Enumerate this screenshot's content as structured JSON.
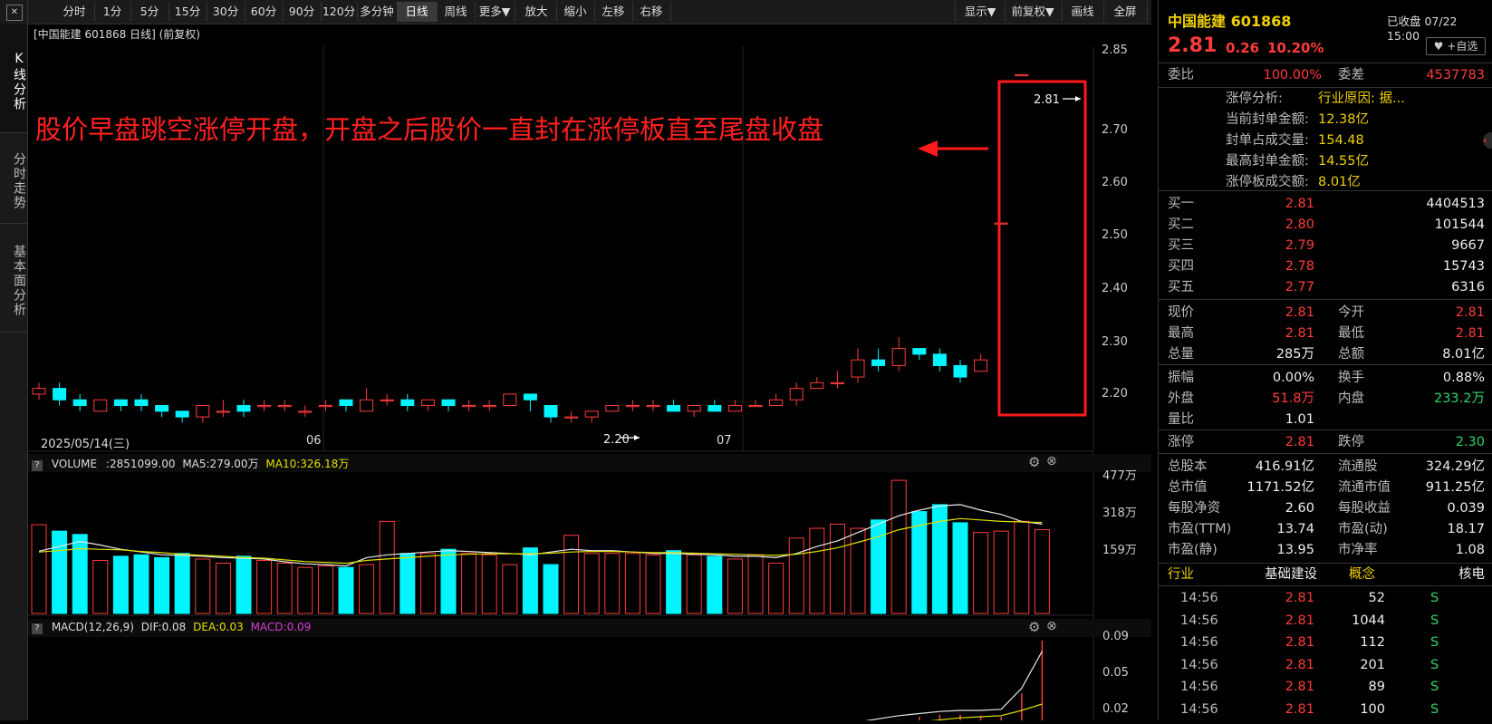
{
  "left_tabs": [
    "K线分析",
    "分时走势",
    "基本面分析"
  ],
  "toolbar": {
    "periods": [
      "分时",
      "1分",
      "5分",
      "15分",
      "30分",
      "60分",
      "90分",
      "120分",
      "多分钟",
      "日线",
      "周线",
      "更多▼"
    ],
    "active_period": "日线",
    "actions": [
      "放大",
      "缩小",
      "左移",
      "右移"
    ],
    "right_actions": [
      "显示▼",
      "前复权▼",
      "画线",
      "全屏"
    ]
  },
  "chart": {
    "title": "[中国能建 601868 日线]  (前复权)",
    "annotation": "股价早盘跳空涨停开盘，开盘之后股价一直封在涨停板直至尾盘收盘",
    "max_label": "2.81",
    "min_label": "2.20",
    "date_labels": [
      "2025/05/14(三)",
      "06",
      "07"
    ],
    "price_ticks": [
      "2.85",
      "2.70",
      "2.60",
      "2.50",
      "2.40",
      "2.30",
      "2.20"
    ],
    "volume_header": {
      "name": "VOLUME",
      "value": ":2851099.00",
      "ma5": "MA5:279.00万",
      "ma10": "MA10:326.18万"
    },
    "volume_ticks": [
      "477万",
      "318万",
      "159万"
    ],
    "macd_header": {
      "name": "MACD(12,26,9)",
      "dif": "DIF:0.08",
      "dea": "DEA:0.03",
      "macd": "MACD:0.09"
    },
    "macd_ticks": [
      "0.09",
      "0.05",
      "0.02"
    ],
    "colors": {
      "up": "#ff3b3b",
      "down": "#00f5ff",
      "ma5": "#e8e8e8",
      "ma10": "#e0e000",
      "annot": "#ff2020",
      "macd": "#d13cd1"
    }
  },
  "chart_data": {
    "type": "candlestick",
    "price_range": [
      2.18,
      2.86
    ],
    "candles": [
      [
        2.25,
        2.26,
        2.24,
        2.27
      ],
      [
        2.26,
        2.24,
        2.23,
        2.27
      ],
      [
        2.24,
        2.23,
        2.22,
        2.25
      ],
      [
        2.22,
        2.24,
        2.22,
        2.24
      ],
      [
        2.24,
        2.23,
        2.22,
        2.24
      ],
      [
        2.24,
        2.23,
        2.22,
        2.25
      ],
      [
        2.23,
        2.22,
        2.21,
        2.23
      ],
      [
        2.22,
        2.21,
        2.2,
        2.22
      ],
      [
        2.21,
        2.23,
        2.2,
        2.23
      ],
      [
        2.22,
        2.22,
        2.21,
        2.24
      ],
      [
        2.23,
        2.22,
        2.21,
        2.24
      ],
      [
        2.23,
        2.23,
        2.22,
        2.24
      ],
      [
        2.23,
        2.23,
        2.22,
        2.24
      ],
      [
        2.22,
        2.22,
        2.21,
        2.23
      ],
      [
        2.23,
        2.23,
        2.22,
        2.24
      ],
      [
        2.24,
        2.23,
        2.22,
        2.24
      ],
      [
        2.22,
        2.24,
        2.22,
        2.26
      ],
      [
        2.24,
        2.24,
        2.23,
        2.25
      ],
      [
        2.24,
        2.23,
        2.22,
        2.25
      ],
      [
        2.23,
        2.24,
        2.22,
        2.24
      ],
      [
        2.24,
        2.23,
        2.22,
        2.24
      ],
      [
        2.23,
        2.23,
        2.22,
        2.24
      ],
      [
        2.23,
        2.23,
        2.22,
        2.24
      ],
      [
        2.23,
        2.25,
        2.23,
        2.25
      ],
      [
        2.25,
        2.24,
        2.22,
        2.25
      ],
      [
        2.23,
        2.21,
        2.2,
        2.23
      ],
      [
        2.21,
        2.21,
        2.2,
        2.22
      ],
      [
        2.21,
        2.22,
        2.2,
        2.22
      ],
      [
        2.22,
        2.23,
        2.22,
        2.23
      ],
      [
        2.23,
        2.23,
        2.22,
        2.24
      ],
      [
        2.23,
        2.23,
        2.22,
        2.24
      ],
      [
        2.23,
        2.22,
        2.22,
        2.24
      ],
      [
        2.22,
        2.23,
        2.21,
        2.23
      ],
      [
        2.23,
        2.22,
        2.22,
        2.24
      ],
      [
        2.22,
        2.23,
        2.22,
        2.24
      ],
      [
        2.23,
        2.23,
        2.23,
        2.24
      ],
      [
        2.23,
        2.24,
        2.23,
        2.25
      ],
      [
        2.24,
        2.26,
        2.23,
        2.27
      ],
      [
        2.26,
        2.27,
        2.26,
        2.28
      ],
      [
        2.27,
        2.27,
        2.26,
        2.29
      ],
      [
        2.28,
        2.31,
        2.27,
        2.33
      ],
      [
        2.31,
        2.3,
        2.29,
        2.33
      ],
      [
        2.3,
        2.33,
        2.29,
        2.35
      ],
      [
        2.33,
        2.32,
        2.31,
        2.33
      ],
      [
        2.32,
        2.3,
        2.29,
        2.33
      ],
      [
        2.3,
        2.28,
        2.27,
        2.31
      ],
      [
        2.29,
        2.31,
        2.29,
        2.32
      ],
      [
        2.55,
        2.55,
        2.55,
        2.55
      ],
      [
        2.81,
        2.81,
        2.81,
        2.81
      ]
    ],
    "volume": [
      318,
      295,
      283,
      190,
      205,
      210,
      200,
      215,
      195,
      180,
      205,
      190,
      180,
      165,
      170,
      165,
      175,
      330,
      215,
      215,
      230,
      215,
      210,
      175,
      235,
      175,
      280,
      215,
      215,
      215,
      210,
      225,
      210,
      205,
      195,
      210,
      180,
      270,
      305,
      320,
      305,
      335,
      477,
      365,
      390,
      325,
      290,
      295,
      330,
      300
    ],
    "volume_max": 500,
    "ma5": [
      223,
      240,
      258,
      245,
      230,
      220,
      210,
      208,
      205,
      200,
      198,
      195,
      185,
      178,
      175,
      170,
      200,
      210,
      215,
      220,
      225,
      222,
      218,
      215,
      210,
      220,
      230,
      225,
      225,
      220,
      215,
      215,
      212,
      210,
      205,
      205,
      200,
      215,
      240,
      260,
      290,
      320,
      350,
      370,
      385,
      390,
      370,
      355,
      330,
      320
    ],
    "ma10": [
      220,
      225,
      232,
      230,
      228,
      222,
      218,
      212,
      208,
      205,
      200,
      198,
      192,
      186,
      183,
      180,
      190,
      195,
      200,
      205,
      210,
      212,
      214,
      214,
      214,
      216,
      220,
      222,
      222,
      220,
      218,
      218,
      216,
      214,
      212,
      210,
      208,
      212,
      222,
      235,
      255,
      275,
      300,
      315,
      330,
      340,
      335,
      330,
      328,
      326
    ],
    "macd": [
      0.002,
      0.002,
      0.001,
      0.001,
      0.001,
      0.001,
      0.0,
      0.0,
      0.0,
      0.0,
      0.001,
      0.001,
      0.001,
      0.001,
      0.002,
      0.002,
      0.002,
      0.003,
      0.003,
      0.003,
      0.003,
      0.003,
      0.003,
      0.004,
      0.004,
      0.004,
      0.003,
      0.002,
      0.002,
      0.002,
      0.002,
      0.002,
      0.002,
      0.002,
      0.003,
      0.003,
      0.003,
      0.005,
      0.006,
      0.008,
      0.01,
      0.012,
      0.015,
      0.018,
      0.02,
      0.02,
      0.019,
      0.018,
      0.04,
      0.09
    ],
    "dif": [
      0.0,
      0.0,
      0.0,
      0.001,
      0.001,
      0.002,
      0.002,
      0.002,
      0.003,
      0.003,
      0.003,
      0.003,
      0.004,
      0.004,
      0.004,
      0.004,
      0.004,
      0.004,
      0.004,
      0.004,
      0.004,
      0.004,
      0.004,
      0.004,
      0.004,
      0.004,
      0.002,
      0.001,
      0.001,
      0.001,
      0.001,
      0.001,
      0.001,
      0.001,
      0.002,
      0.002,
      0.003,
      0.005,
      0.007,
      0.01,
      0.013,
      0.016,
      0.019,
      0.021,
      0.023,
      0.024,
      0.024,
      0.025,
      0.045,
      0.08
    ],
    "dea": [
      0.0,
      0.0,
      0.0,
      0.0,
      0.001,
      0.001,
      0.001,
      0.002,
      0.002,
      0.002,
      0.002,
      0.003,
      0.003,
      0.003,
      0.003,
      0.003,
      0.003,
      0.003,
      0.003,
      0.003,
      0.003,
      0.003,
      0.003,
      0.003,
      0.003,
      0.003,
      0.003,
      0.002,
      0.002,
      0.002,
      0.002,
      0.002,
      0.002,
      0.002,
      0.002,
      0.002,
      0.002,
      0.003,
      0.004,
      0.005,
      0.007,
      0.009,
      0.011,
      0.013,
      0.015,
      0.017,
      0.018,
      0.019,
      0.024,
      0.03
    ],
    "macd_range": [
      0.0,
      0.09
    ]
  },
  "panel": {
    "name": "中国能建",
    "code": "601868",
    "status": "已收盘 07/22 15:00",
    "price": "2.81",
    "change": "0.26",
    "pct": "10.20%",
    "fav_label": "+自选",
    "weibi_label": "委比",
    "weibi": "100.00%",
    "weicha_label": "委差",
    "weicha": "4537783",
    "limit_info": [
      {
        "label": "涨停分析:",
        "value": "行业原因: 据..."
      },
      {
        "label": "当前封单金额:",
        "value": "12.38亿"
      },
      {
        "label": "封单占成交量:",
        "value": "154.48"
      },
      {
        "label": "最高封单金额:",
        "value": "14.55亿"
      },
      {
        "label": "涨停板成交额:",
        "value": "8.01亿"
      }
    ],
    "bids": [
      {
        "label": "买一",
        "price": "2.81",
        "vol": "4404513"
      },
      {
        "label": "买二",
        "price": "2.80",
        "vol": "101544"
      },
      {
        "label": "买三",
        "price": "2.79",
        "vol": "9667"
      },
      {
        "label": "买四",
        "price": "2.78",
        "vol": "15743"
      },
      {
        "label": "买五",
        "price": "2.77",
        "vol": "6316"
      }
    ],
    "quote": [
      [
        {
          "l": "现价",
          "v": "2.81",
          "c": "red"
        },
        {
          "l": "今开",
          "v": "2.81",
          "c": "red"
        }
      ],
      [
        {
          "l": "最高",
          "v": "2.81",
          "c": "red"
        },
        {
          "l": "最低",
          "v": "2.81",
          "c": "red"
        }
      ],
      [
        {
          "l": "总量",
          "v": "285万",
          "c": "white"
        },
        {
          "l": "总额",
          "v": "8.01亿",
          "c": "white"
        }
      ]
    ],
    "quote2": [
      [
        {
          "l": "振幅",
          "v": "0.00%",
          "c": "white"
        },
        {
          "l": "换手",
          "v": "0.88%",
          "c": "white"
        }
      ],
      [
        {
          "l": "外盘",
          "v": "51.8万",
          "c": "red"
        },
        {
          "l": "内盘",
          "v": "233.2万",
          "c": "green"
        }
      ],
      [
        {
          "l": "量比",
          "v": "1.01",
          "c": "white"
        },
        {
          "l": "",
          "v": "",
          "c": "white"
        }
      ]
    ],
    "limits": [
      {
        "l": "涨停",
        "v": "2.81",
        "c": "red"
      },
      {
        "l": "跌停",
        "v": "2.30",
        "c": "green"
      }
    ],
    "fund": [
      [
        {
          "l": "总股本",
          "v": "416.91亿"
        },
        {
          "l": "流通股",
          "v": "324.29亿"
        }
      ],
      [
        {
          "l": "总市值",
          "v": "1171.52亿"
        },
        {
          "l": "流通市值",
          "v": "911.25亿"
        }
      ],
      [
        {
          "l": "每股净资",
          "v": "2.60"
        },
        {
          "l": "每股收益",
          "v": "0.039"
        }
      ],
      [
        {
          "l": "市盈(TTM)",
          "v": "13.74"
        },
        {
          "l": "市盈(动)",
          "v": "18.17"
        }
      ],
      [
        {
          "l": "市盈(静)",
          "v": "13.95"
        },
        {
          "l": "市净率",
          "v": "1.08"
        }
      ]
    ],
    "industry_label": "行业",
    "industry": "基础建设",
    "concept_label": "概念",
    "concept": "核电",
    "trades": [
      {
        "t": "14:56",
        "p": "2.81",
        "v": "52",
        "s": "S"
      },
      {
        "t": "14:56",
        "p": "2.81",
        "v": "1044",
        "s": "S"
      },
      {
        "t": "14:56",
        "p": "2.81",
        "v": "112",
        "s": "S"
      },
      {
        "t": "14:56",
        "p": "2.81",
        "v": "201",
        "s": "S"
      },
      {
        "t": "14:56",
        "p": "2.81",
        "v": "89",
        "s": "S"
      },
      {
        "t": "14:56",
        "p": "2.81",
        "v": "100",
        "s": "S"
      }
    ]
  }
}
